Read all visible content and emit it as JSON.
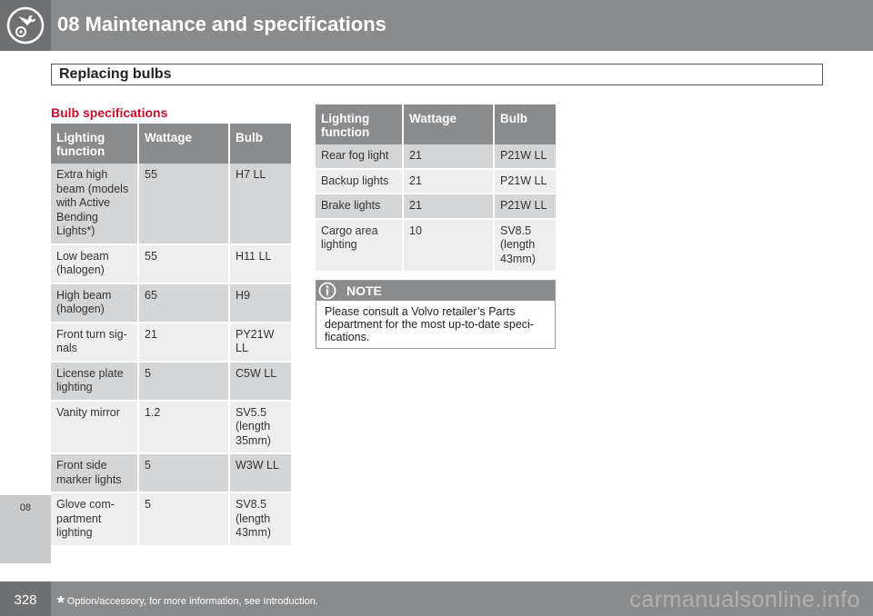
{
  "header": {
    "chapter_title": "08 Maintenance and specifications",
    "section_title": "Replacing bulbs"
  },
  "side_tab": {
    "label": "08"
  },
  "sub_heading": "Bulb specifications",
  "table_left": {
    "headers": [
      "Lighting function",
      "Wattage",
      "Bulb"
    ],
    "rows": [
      [
        "Extra high beam (models with Active Bending Lights*)",
        "55",
        "H7 LL"
      ],
      [
        "Low beam (halogen)",
        "55",
        "H11 LL"
      ],
      [
        "High beam (halogen)",
        "65",
        "H9"
      ],
      [
        "Front turn sig-nals",
        "21",
        "PY21W LL"
      ],
      [
        "License plate lighting",
        "5",
        "C5W LL"
      ],
      [
        "Vanity mirror",
        "1.2",
        "SV5.5 (length 35mm)"
      ],
      [
        "Front side marker lights",
        "5",
        "W3W LL"
      ],
      [
        "Glove com-partment lighting",
        "5",
        "SV8.5 (length 43mm)"
      ]
    ]
  },
  "table_right": {
    "headers": [
      "Lighting function",
      "Wattage",
      "Bulb"
    ],
    "rows": [
      [
        "Rear fog light",
        "21",
        "P21W LL"
      ],
      [
        "Backup lights",
        "21",
        "P21W LL"
      ],
      [
        "Brake lights",
        "21",
        "P21W LL"
      ],
      [
        "Cargo area lighting",
        "10",
        "SV8.5 (length 43mm)"
      ]
    ]
  },
  "note": {
    "title": "NOTE",
    "text": "Please consult a Volvo retailer’s Parts department for the most up-to-date speci-fications."
  },
  "footer": {
    "page_number": "328",
    "star": "*",
    "footnote": "Option/accessory, for more information, see Introduction."
  },
  "watermark": "carmanualsonline.info",
  "colors": {
    "header_grey": "#8a8b8d",
    "dark_grey": "#6f7072",
    "accent_red": "#c8102e",
    "row_dark": "#d4d5d6",
    "row_light": "#eeeeee"
  },
  "icons": {
    "chapter_icon": "wrench-gear-icon",
    "note_icon": "info-icon"
  }
}
